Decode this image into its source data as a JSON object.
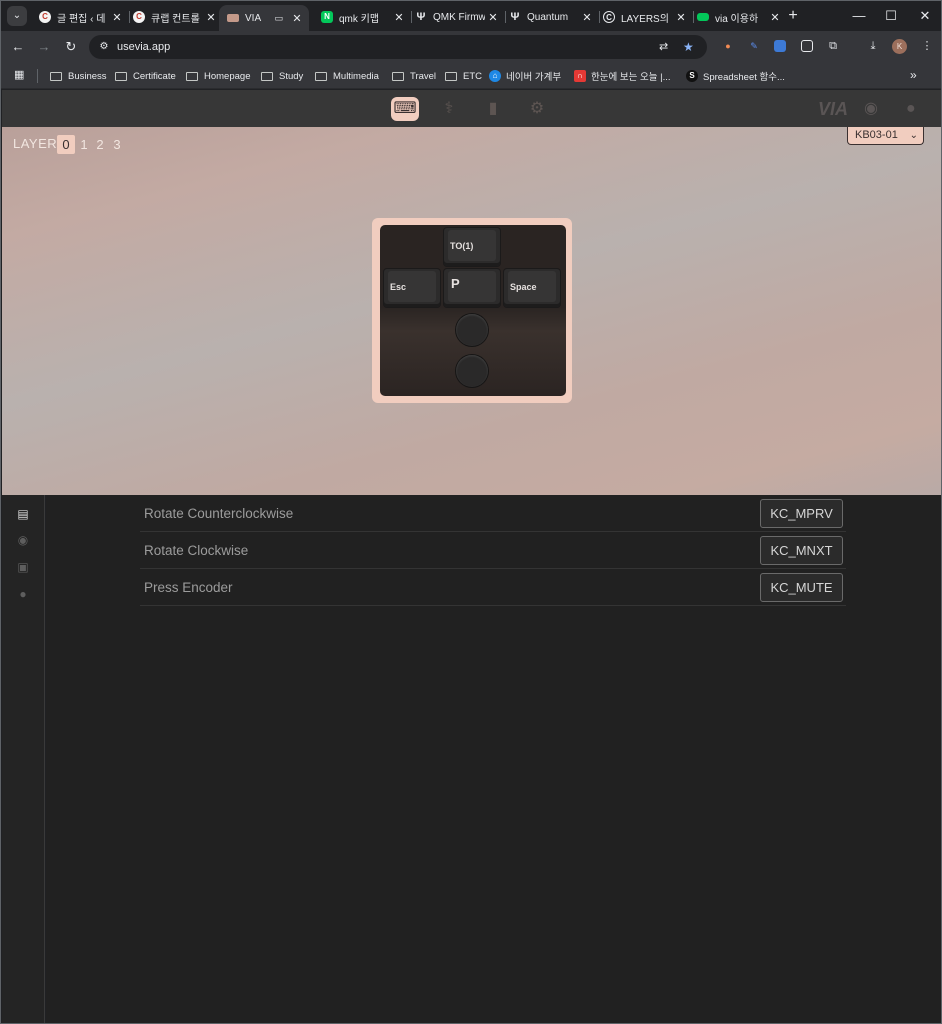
{
  "browser": {
    "tabs": [
      {
        "title": "글 편집 ‹ 데",
        "favicon": "C",
        "active": false
      },
      {
        "title": "큐랩 컨트롤",
        "favicon": "C",
        "active": false
      },
      {
        "title": "VIA",
        "favicon": "via",
        "active": true
      },
      {
        "title": "qmk 키맵",
        "favicon": "N",
        "active": false
      },
      {
        "title": "QMK Firmw",
        "favicon": "psi",
        "active": false
      },
      {
        "title": "Quantum",
        "favicon": "psi",
        "active": false
      },
      {
        "title": "LAYERS의",
        "favicon": "C",
        "active": false
      },
      {
        "title": "via 이용하",
        "favicon": "green",
        "active": false
      }
    ],
    "new_tab": "+",
    "window_controls": {
      "minimize": "—",
      "maximize": "☐",
      "close": "✕"
    },
    "address": {
      "url": "usevia.app"
    },
    "profile_initial": "K",
    "bookmarks": [
      {
        "label": "Business",
        "type": "folder"
      },
      {
        "label": "Certificate",
        "type": "folder"
      },
      {
        "label": "Homepage",
        "type": "folder"
      },
      {
        "label": "Study",
        "type": "folder"
      },
      {
        "label": "Multimedia",
        "type": "folder"
      },
      {
        "label": "Travel",
        "type": "folder"
      },
      {
        "label": "ETC",
        "type": "folder"
      },
      {
        "label": "네이버 가계부",
        "type": "site"
      },
      {
        "label": "한눈에 보는 오늘 |...",
        "type": "site"
      },
      {
        "label": "Spreadsheet 함수...",
        "type": "site"
      }
    ],
    "bookmarks_more": "»"
  },
  "via": {
    "logo_text": "VIA",
    "layer_label": "LAYER",
    "layers": [
      "0",
      "1",
      "2",
      "3"
    ],
    "active_layer": "0",
    "device": "KB03-01",
    "keys": {
      "top": "TO(1)",
      "left": "Esc",
      "center": "P",
      "right": "Space"
    },
    "encoder_rows": [
      {
        "label": "Rotate Counterclockwise",
        "keycode": "KC_MPRV"
      },
      {
        "label": "Rotate Clockwise",
        "keycode": "KC_MNXT"
      },
      {
        "label": "Press Encoder",
        "keycode": "KC_MUTE"
      }
    ],
    "accent_color": "#f1cdbf"
  }
}
